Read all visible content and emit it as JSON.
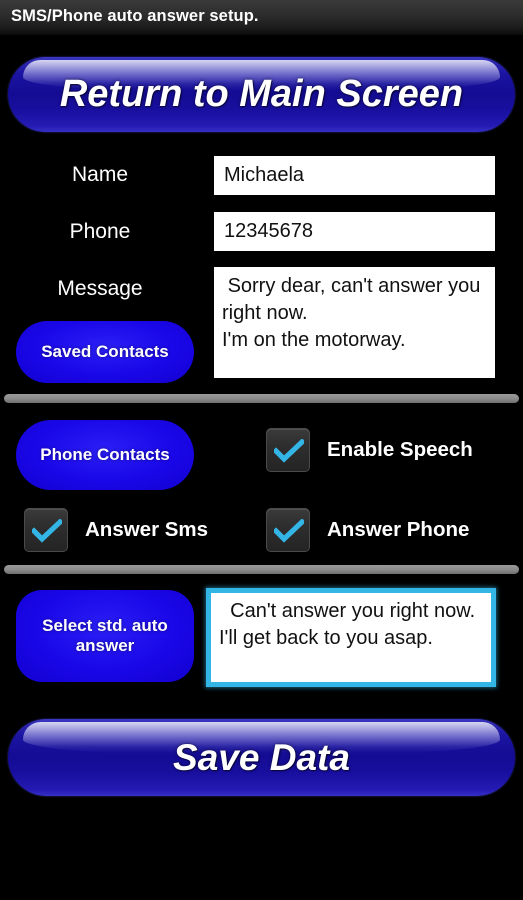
{
  "titlebar": {
    "title": "SMS/Phone auto answer setup."
  },
  "buttons": {
    "return_to_main": "Return to Main Screen",
    "save_data": "Save Data",
    "saved_contacts": "Saved Contacts",
    "phone_contacts": "Phone Contacts",
    "select_std_auto_answer": "Select std. auto answer"
  },
  "form": {
    "name_label": "Name",
    "name_value": "Michaela",
    "phone_label": "Phone",
    "phone_value": "12345678",
    "message_label": "Message",
    "message_value": " Sorry dear, can't answer you right now.\nI'm on the motorway."
  },
  "std_answer": {
    "value": "  Can't answer you right now.\nI'll get back to you asap."
  },
  "checkboxes": [
    {
      "label": "Enable Speech",
      "checked": true
    },
    {
      "label": "Answer Sms",
      "checked": true
    },
    {
      "label": "Answer Phone",
      "checked": true
    }
  ],
  "colors": {
    "accent_blue": "#1200cf",
    "check_blue": "#33b5e5",
    "background": "#000000",
    "field_background": "#ffffff",
    "divider": "#8a8a8a"
  }
}
